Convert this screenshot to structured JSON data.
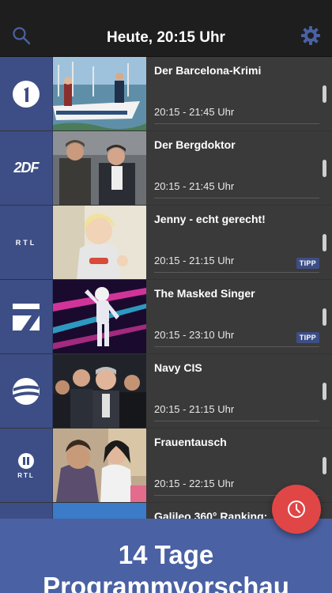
{
  "header": {
    "title": "Heute, 20:15 Uhr",
    "search_icon": "search-icon",
    "settings_icon": "gear-icon"
  },
  "colors": {
    "accent": "#3d4e86",
    "fab": "#e04646",
    "banner": "#4a61a3"
  },
  "programs": [
    {
      "channel_logo": "das-erste-logo",
      "title": "Der Barcelona-Krimi",
      "time": "20:15 - 21:45 Uhr",
      "tipp": ""
    },
    {
      "channel_logo": "zdf-logo",
      "title": "Der Bergdoktor",
      "time": "20:15 - 21:45 Uhr",
      "tipp": ""
    },
    {
      "channel_logo": "rtl-logo",
      "title": "Jenny - echt gerecht!",
      "time": "20:15 - 21:15 Uhr",
      "tipp": "TIPP"
    },
    {
      "channel_logo": "prosieben-logo",
      "title": "The Masked Singer",
      "time": "20:15 - 23:10 Uhr",
      "tipp": "TIPP"
    },
    {
      "channel_logo": "sat1-logo",
      "title": "Navy CIS",
      "time": "20:15 - 21:15 Uhr",
      "tipp": ""
    },
    {
      "channel_logo": "rtl2-logo",
      "title": "Frauentausch",
      "time": "20:15 - 22:15 Uhr",
      "tipp": ""
    },
    {
      "channel_logo": "kabel1-logo",
      "title": "Galileo 360° Ranking:",
      "time": "",
      "tipp": ""
    }
  ],
  "logo_texts": {
    "zdf": "2DF",
    "rtl": "RTL",
    "rtl2": "RTL"
  },
  "fab_icon": "clock-icon",
  "banner": {
    "line1": "14 Tage",
    "line2": "Programmvorschau"
  }
}
